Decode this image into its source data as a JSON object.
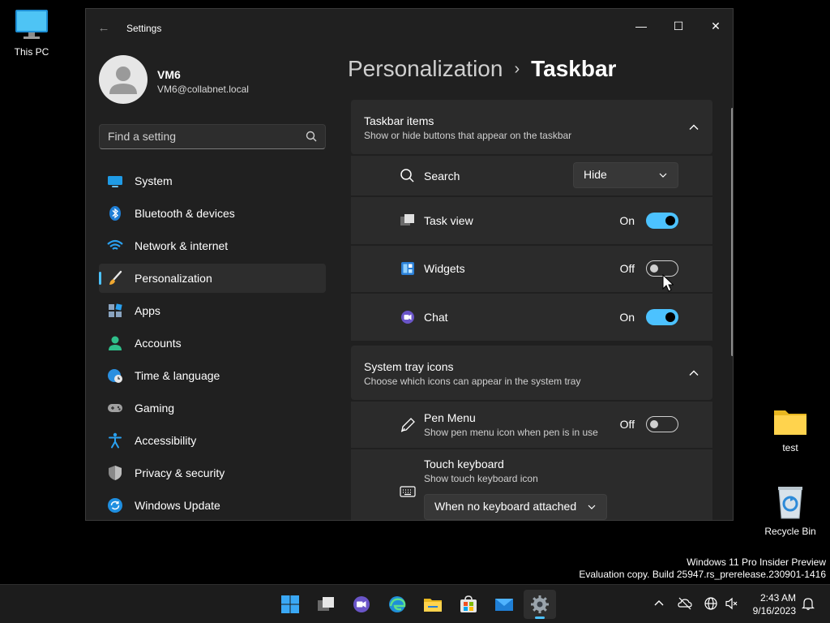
{
  "desktop": {
    "icons": [
      {
        "label": "This PC"
      },
      {
        "label": "test"
      },
      {
        "label": "Recycle Bin"
      }
    ],
    "watermark": {
      "line1": "Windows 11 Pro Insider Preview",
      "line2": "Evaluation copy. Build 25947.rs_prerelease.230901-1416"
    }
  },
  "window": {
    "title": "Settings",
    "controls": {
      "minimize": "—",
      "maximize": "☐",
      "close": "✕"
    }
  },
  "profile": {
    "name": "VM6",
    "email": "VM6@collabnet.local"
  },
  "search": {
    "placeholder": "Find a setting"
  },
  "nav": {
    "items": [
      {
        "label": "System",
        "icon": "system-icon"
      },
      {
        "label": "Bluetooth & devices",
        "icon": "bluetooth-icon"
      },
      {
        "label": "Network & internet",
        "icon": "wifi-icon"
      },
      {
        "label": "Personalization",
        "icon": "brush-icon",
        "active": true
      },
      {
        "label": "Apps",
        "icon": "apps-icon"
      },
      {
        "label": "Accounts",
        "icon": "accounts-icon"
      },
      {
        "label": "Time & language",
        "icon": "globe-clock-icon"
      },
      {
        "label": "Gaming",
        "icon": "gamepad-icon"
      },
      {
        "label": "Accessibility",
        "icon": "accessibility-icon"
      },
      {
        "label": "Privacy & security",
        "icon": "shield-icon"
      },
      {
        "label": "Windows Update",
        "icon": "update-icon"
      }
    ]
  },
  "breadcrumb": {
    "parent": "Personalization",
    "separator": "›",
    "current": "Taskbar"
  },
  "taskbar_items": {
    "title": "Taskbar items",
    "subtitle": "Show or hide buttons that appear on the taskbar",
    "search": {
      "label": "Search",
      "value": "Hide"
    },
    "task_view": {
      "label": "Task view",
      "state": "On"
    },
    "widgets": {
      "label": "Widgets",
      "state": "Off"
    },
    "chat": {
      "label": "Chat",
      "state": "On"
    }
  },
  "system_tray": {
    "title": "System tray icons",
    "subtitle": "Choose which icons can appear in the system tray",
    "pen_menu": {
      "label": "Pen Menu",
      "sublabel": "Show pen menu icon when pen is in use",
      "state": "Off"
    },
    "touch_keyboard": {
      "label": "Touch keyboard",
      "sublabel": "Show touch keyboard icon",
      "value": "When no keyboard attached"
    }
  },
  "taskbar": {
    "apps": [
      "start-icon",
      "task-view-icon",
      "chat-icon",
      "edge-icon",
      "file-explorer-icon",
      "store-icon",
      "mail-icon",
      "settings-icon"
    ],
    "clock": {
      "time": "2:43 AM",
      "date": "9/16/2023"
    }
  },
  "colors": {
    "accent": "#4cc2ff",
    "window_bg": "#202020",
    "card_bg": "#2b2b2b"
  }
}
